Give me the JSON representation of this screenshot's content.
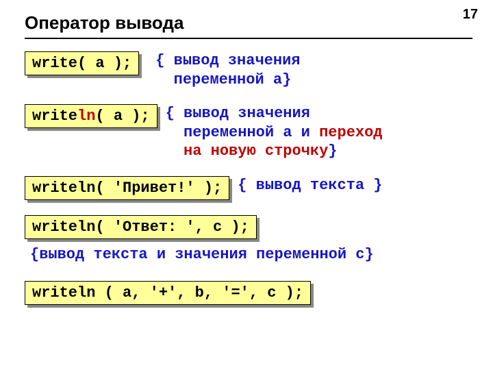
{
  "page_number": "17",
  "title": "Оператор вывода",
  "row1": {
    "code_pre": "write( a );",
    "comment_open": "{ ",
    "comment_l1": "вывод значения",
    "comment_l2": "переменной a",
    "comment_close": "}"
  },
  "row2": {
    "code_part1": "write",
    "code_ln": "ln",
    "code_part2": "( a );",
    "comment_open": "{ ",
    "comment_l1": "вывод значения",
    "comment_l2a": "переменной a и ",
    "comment_l2b_red": "переход",
    "comment_l3_red": "на новую строчку",
    "comment_close": "}"
  },
  "row3": {
    "code": "writeln( 'Привет!' );",
    "comment": "{ вывод текста }"
  },
  "row4": {
    "code": "writeln( 'Ответ: ', c );",
    "comment": "{вывод текста и значения переменной c}"
  },
  "row5": {
    "code": "writeln ( a, '+', b, '=', c );"
  }
}
